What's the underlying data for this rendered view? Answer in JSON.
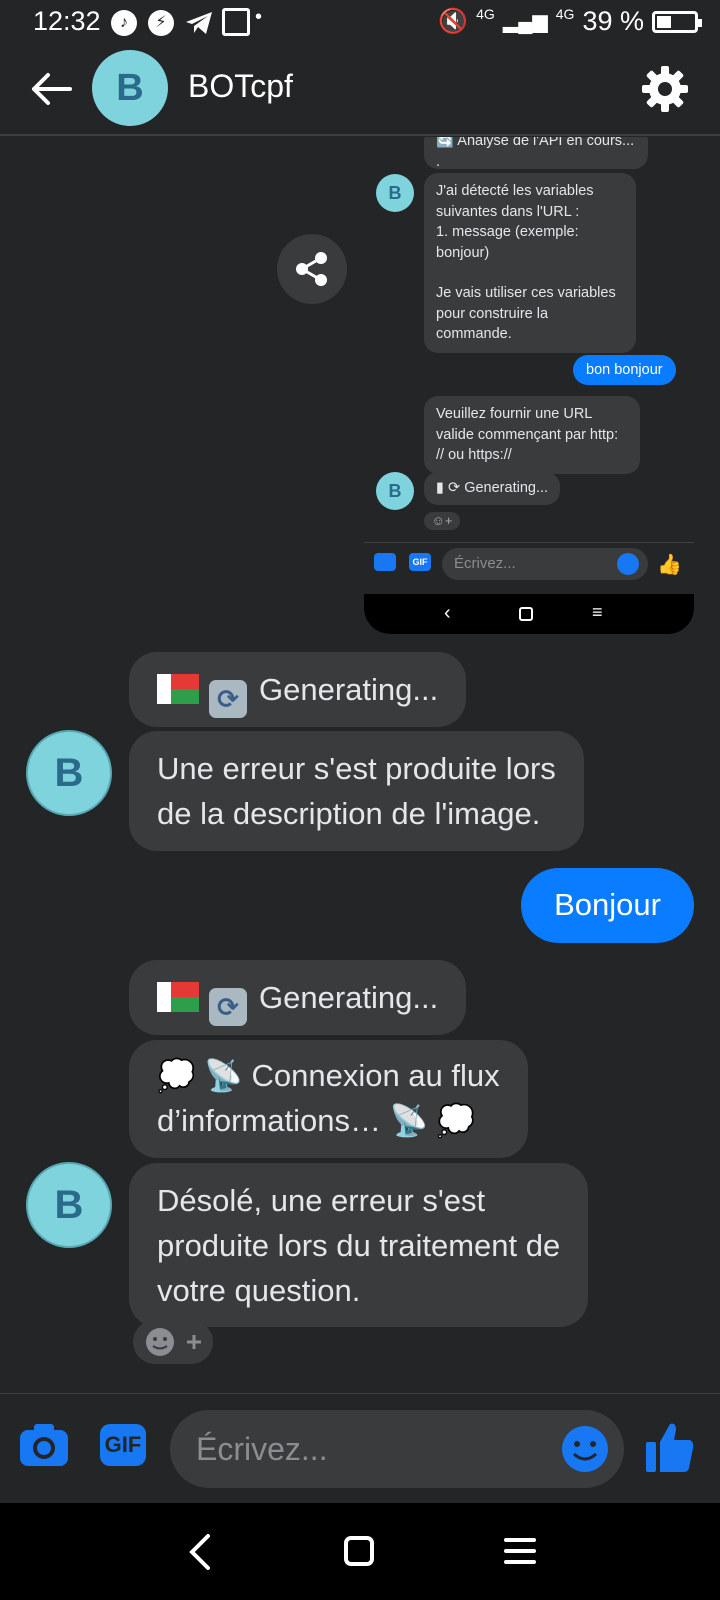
{
  "status_bar": {
    "time": "12:32",
    "network_1": "4G",
    "network_2": "4G",
    "battery": "39 %"
  },
  "header": {
    "avatar_letter": "B",
    "title": "BOTcpf"
  },
  "inner_screenshot": {
    "top_cut_text": "🔄 Analyse de l'API en cours...",
    "top_cut_dot": ".",
    "avatar_letter": "B",
    "variables_msg": {
      "line1": "J'ai détecté les variables",
      "line2": "suivantes dans l'URL :",
      "line3": "1. message (exemple:",
      "line4": "bonjour)",
      "line5": "Je vais utiliser ces variables",
      "line6": "pour construire la",
      "line7": "commande."
    },
    "user_msg": "bon bonjour",
    "url_msg": {
      "line1": "Veuillez fournir une URL",
      "line2": "valide commençant par http:",
      "line3": "// ou https://"
    },
    "generating": "Generating...",
    "input_placeholder": "Écrivez...",
    "gif_label": "GIF"
  },
  "messages": {
    "generating_1": "Generating...",
    "error_1": {
      "line1": "Une erreur s'est produite lors",
      "line2": "de la description de l'image."
    },
    "user_bonjour": "Bonjour",
    "generating_2": "Generating...",
    "connexion": {
      "line1": "Connexion au flux",
      "line2": "d’informations…"
    },
    "error_2": {
      "line1": "Désolé, une erreur s'est",
      "line2": "produite lors du traitement de",
      "line3": "votre question."
    },
    "avatar_letter": "B"
  },
  "composer": {
    "placeholder": "Écrivez...",
    "gif_label": "GIF"
  },
  "colors": {
    "background": "#242526",
    "bubble_bot": "#3a3b3c",
    "bubble_user": "#0a7cff",
    "avatar": "#7fd3dc",
    "accent": "#1877f2"
  }
}
